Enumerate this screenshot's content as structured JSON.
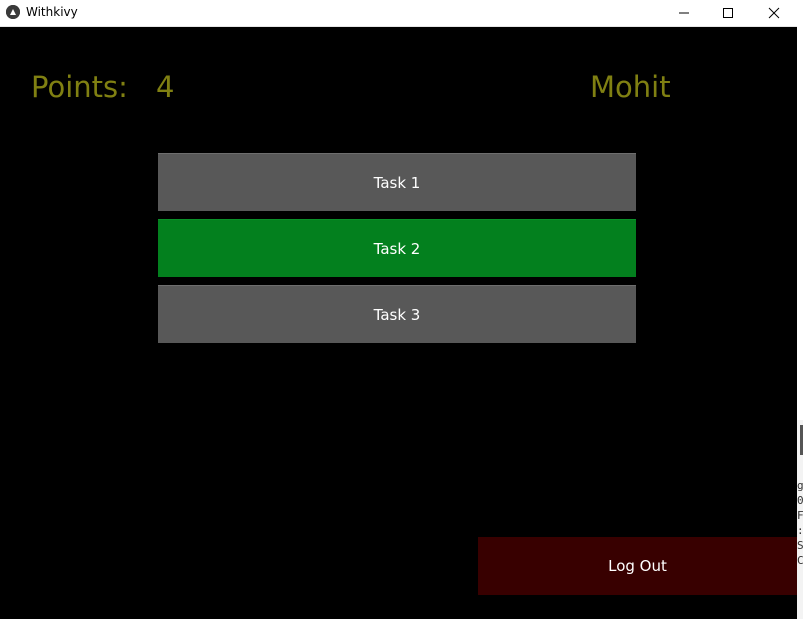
{
  "window": {
    "title": "Withkivy",
    "controls": {
      "minimize_icon": "minimize-icon",
      "maximize_icon": "maximize-icon",
      "close_icon": "close-icon"
    }
  },
  "header": {
    "points_label": "Points:",
    "points_value": "4",
    "username": "Mohit",
    "text_color": "#808012"
  },
  "tasks": [
    {
      "label": "Task 1",
      "state": "default",
      "color": "#585858"
    },
    {
      "label": "Task 2",
      "state": "completed",
      "color": "#03801e"
    },
    {
      "label": "Task 3",
      "state": "default",
      "color": "#585858"
    }
  ],
  "footer": {
    "logout_label": "Log Out",
    "logout_color": "#380000"
  },
  "background_window": {
    "glyphs": "g\n0,\nF\n:\nSe\nC"
  }
}
